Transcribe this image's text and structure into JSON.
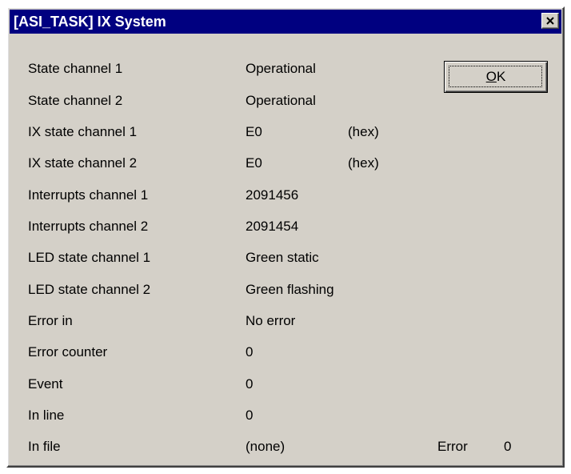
{
  "window": {
    "title": "[ASI_TASK] IX System"
  },
  "buttons": {
    "ok_accel": "O",
    "ok_rest": "K"
  },
  "rows": [
    {
      "label": "State channel 1",
      "value": "Operational"
    },
    {
      "label": "State channel 2",
      "value": "Operational"
    },
    {
      "label": "IX state channel 1",
      "value": "E0",
      "unit": "(hex)"
    },
    {
      "label": "IX state channel 2",
      "value": "E0",
      "unit": "(hex)"
    },
    {
      "label": "Interrupts channel 1",
      "value": "2091456"
    },
    {
      "label": "Interrupts channel 2",
      "value": "2091454"
    },
    {
      "label": "LED state channel 1",
      "value": "Green static"
    },
    {
      "label": "LED state channel 2",
      "value": "Green flashing"
    },
    {
      "label": "Error in",
      "value": "No error"
    },
    {
      "label": "Error counter",
      "value": "0"
    },
    {
      "label": "Event",
      "value": "0"
    },
    {
      "label": "In line",
      "value": "0"
    },
    {
      "label": "In file",
      "value": "(none)",
      "extra_label": "Error",
      "extra_value": "0"
    }
  ],
  "icons": {
    "close": "close-icon"
  },
  "colors": {
    "titlebar": "#000080",
    "face": "#d4d0c8"
  }
}
